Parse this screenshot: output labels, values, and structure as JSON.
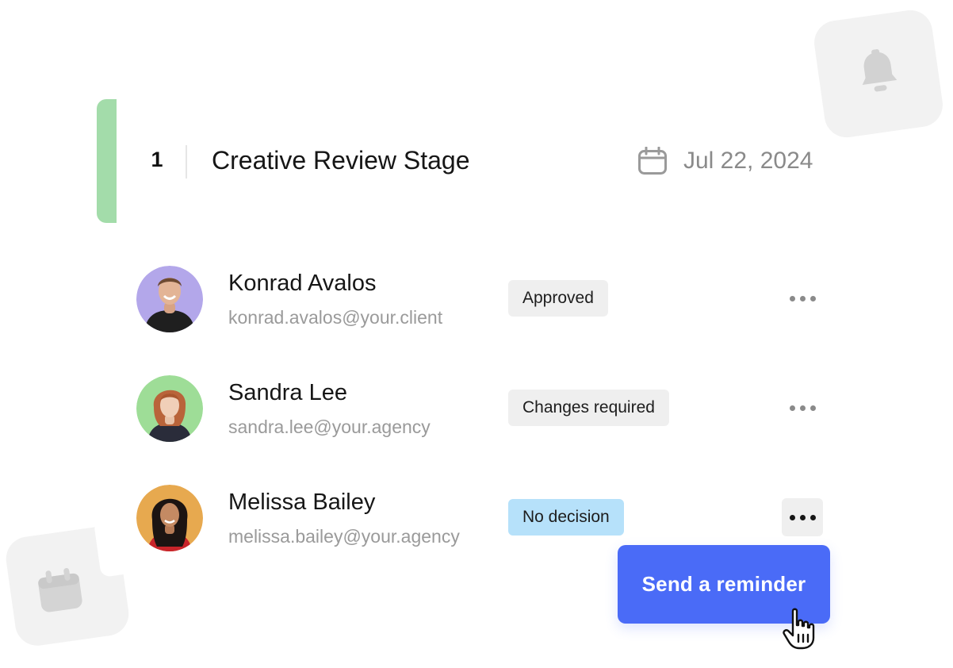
{
  "stage": {
    "number": "1",
    "title": "Creative Review Stage",
    "date": "Jul 22, 2024",
    "accent_color": "#a3dcaa",
    "date_icon": "calendar-icon"
  },
  "reviewers": [
    {
      "name": "Konrad Avalos",
      "email": "konrad.avalos@your.client",
      "status": "Approved",
      "avatar_bg": "#b3a7ea",
      "menu_icon": "more-horizontal-icon"
    },
    {
      "name": "Sandra Lee",
      "email": "sandra.lee@your.agency",
      "status": "Changes required",
      "avatar_bg": "#9edd97",
      "menu_icon": "more-horizontal-icon"
    },
    {
      "name": "Melissa Bailey",
      "email": "melissa.bailey@your.agency",
      "status": "No decision",
      "status_color": "#b6e1fa",
      "avatar_bg": "#e7a94f",
      "menu_icon": "more-horizontal-icon"
    }
  ],
  "actions": {
    "send_reminder_label": "Send a reminder",
    "button_color": "#4a6bf7",
    "cursor_icon": "hand-pointer-icon"
  },
  "decor": {
    "bell_icon": "bell-icon",
    "calendar_icon": "calendar-icon"
  }
}
